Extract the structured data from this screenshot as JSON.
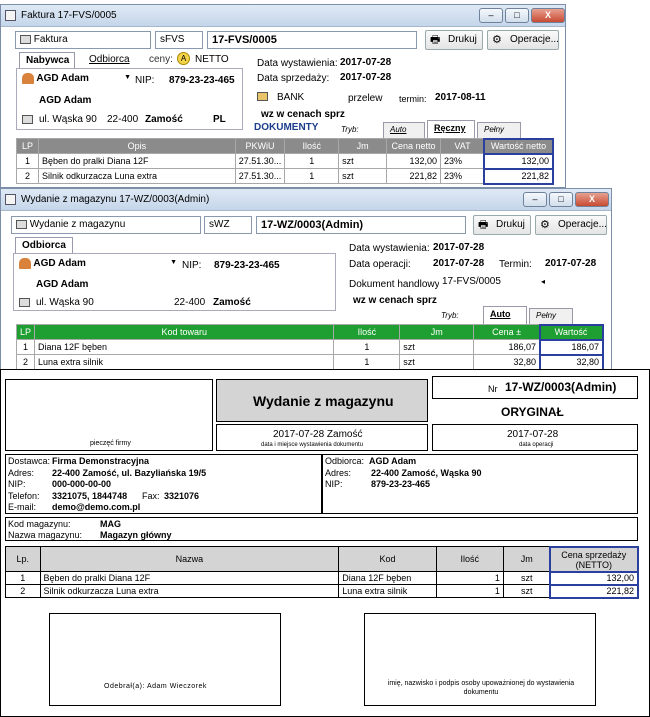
{
  "w1": {
    "title": "Faktura 17-FVS/0005",
    "min": "–",
    "max": "□",
    "close": "X",
    "type": "Faktura",
    "series": "sFVS",
    "number": "17-FVS/0005",
    "print": "Drukuj",
    "ops": "Operacje...",
    "tab_buyer": "Nabywca",
    "tab_recipient": "Odbiorca",
    "price_lbl": "ceny:",
    "price_val": "NETTO",
    "price_mark": "A",
    "client": "AGD Adam",
    "nip_lbl": "NIP:",
    "nip": "879-23-23-465",
    "client_name": "AGD Adam",
    "street": "ul. Wąska 90",
    "postal": "22-400",
    "city": "Zamość",
    "country": "PL",
    "issue_lbl": "Data wystawienia:",
    "issue": "2017-07-28",
    "sale_lbl": "Data sprzedaży:",
    "sale": "2017-07-28",
    "pay_type": "BANK",
    "pay_method": "przelew",
    "term_lbl": "termin:",
    "term": "2017-08-11",
    "wz": "wz w cenach sprz",
    "docs": "DOKUMENTY",
    "mode_lbl": "Tryb:",
    "mode_auto": "Auto",
    "mode_manual": "Ręczny",
    "mode_full": "Pełny",
    "cols": [
      "LP",
      "Opis",
      "PKWiU",
      "Ilość",
      "Jm",
      "Cena netto",
      "VAT",
      "Wartość netto"
    ],
    "rows": [
      [
        "1",
        "Bęben do pralki Diana 12F",
        "27.51.30...",
        "1",
        "szt",
        "132,00",
        "23%",
        "132,00"
      ],
      [
        "2",
        "Silnik odkurzacza Luna extra",
        "27.51.30...",
        "1",
        "szt",
        "221,82",
        "23%",
        "221,82"
      ]
    ]
  },
  "w2": {
    "title": "Wydanie z magazynu 17-WZ/0003(Admin)",
    "min": "–",
    "max": "□",
    "close": "X",
    "type": "Wydanie z magazynu",
    "series": "sWZ",
    "number": "17-WZ/0003(Admin)",
    "print": "Drukuj",
    "ops": "Operacje...",
    "tab_recipient": "Odbiorca",
    "client": "AGD Adam",
    "nip_lbl": "NIP:",
    "nip": "879-23-23-465",
    "client_name": "AGD Adam",
    "street": "ul. Wąska 90",
    "postal": "22-400",
    "city": "Zamość",
    "issue_lbl": "Data wystawienia:",
    "issue": "2017-07-28",
    "op_lbl": "Data operacji:",
    "op": "2017-07-28",
    "term_lbl": "Termin:",
    "term": "2017-07-28",
    "trade_lbl": "Dokument handlowy:",
    "trade_doc": "17-FVS/0005",
    "wz": "wz w cenach sprz",
    "mode_lbl": "Tryb:",
    "mode_auto": "Auto",
    "mode_full": "Pełny",
    "cols": [
      "LP",
      "Kod towaru",
      "Ilość",
      "Jm",
      "Cena ±",
      "Wartość"
    ],
    "rows": [
      [
        "1",
        "Diana 12F bęben",
        "1",
        "szt",
        "186,07",
        "186,07"
      ],
      [
        "2",
        "Luna extra silnik",
        "1",
        "szt",
        "32,80",
        "32,80"
      ]
    ]
  },
  "doc": {
    "title": "Wydanie z magazynu",
    "nr_lbl": "Nr",
    "nr": "17-WZ/0003(Admin)",
    "original": "ORYGINAŁ",
    "stamp": "pieczęć firmy",
    "date_place": "2017-07-28  Zamość",
    "date_place_lbl": "data i miejsce wystawienia dokumentu",
    "op_date": "2017-07-28",
    "op_date_lbl": "data operacji",
    "supplier_lbl": "Dostawca:",
    "supplier": "Firma Demonstracyjna",
    "addr_lbl": "Adres:",
    "supplier_addr": "22-400 Zamość, ul. Bazyliańska 19/5",
    "nip_lbl": "NIP:",
    "supplier_nip": "000-000-00-00",
    "phone_lbl": "Telefon:",
    "phone": "3321075, 1844748",
    "fax_lbl": "Fax:",
    "fax": "3321076",
    "email_lbl": "E-mail:",
    "email": "demo@demo.com.pl",
    "recv_lbl": "Odbiorca:",
    "recv": "AGD Adam",
    "recv_addr_lbl": "Adres:",
    "recv_addr": "22-400 Zamość, Wąska 90",
    "recv_nip_lbl": "NIP:",
    "recv_nip": "879-23-23-465",
    "wh_code_lbl": "Kod magazynu:",
    "wh_code": "MAG",
    "wh_name_lbl": "Nazwa magazynu:",
    "wh_name": "Magazyn główny",
    "cols": [
      "Lp.",
      "Nazwa",
      "Kod",
      "Ilość",
      "Jm",
      "Cena sprzedaży (NETTO)"
    ],
    "rows": [
      [
        "1",
        "Bęben do pralki Diana 12F",
        "Diana 12F bęben",
        "1",
        "szt",
        "132,00"
      ],
      [
        "2",
        "Silnik odkurzacza Luna extra",
        "Luna extra silnik",
        "1",
        "szt",
        "221,82"
      ]
    ],
    "received": "Odebrał(a): Adam Wieczorek",
    "signature": "imię, nazwisko i podpis osoby upoważnionej do wystawienia dokumentu"
  }
}
